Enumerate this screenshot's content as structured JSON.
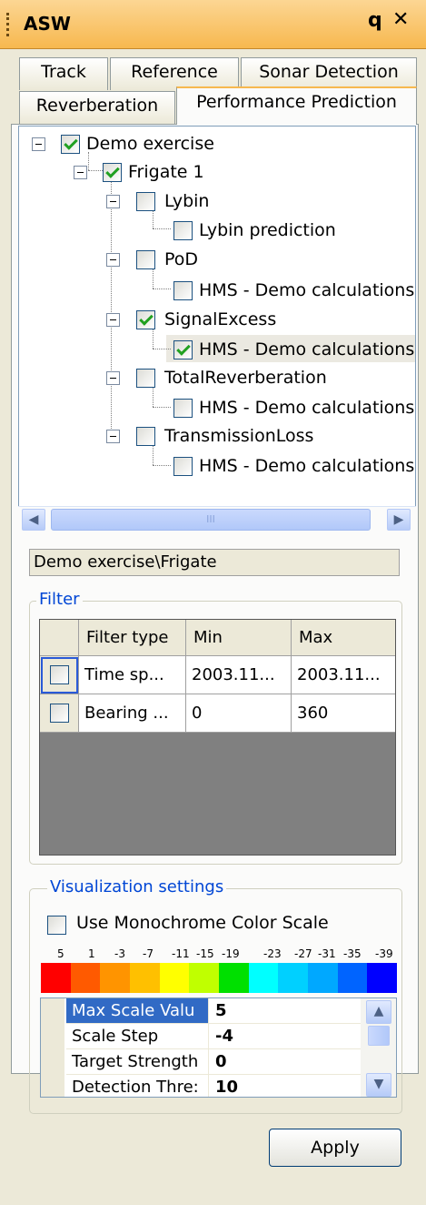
{
  "window": {
    "title": "ASW"
  },
  "tabs": {
    "row1": [
      "Track",
      "Reference",
      "Sonar Detection"
    ],
    "row2": [
      "Reverberation",
      "Performance Prediction"
    ]
  },
  "tree": {
    "nodes": [
      {
        "label": "Demo exercise",
        "checked": true
      },
      {
        "label": "Frigate 1",
        "checked": true
      },
      {
        "label": "Lybin",
        "checked": false
      },
      {
        "label": "Lybin prediction",
        "checked": false
      },
      {
        "label": "PoD",
        "checked": false
      },
      {
        "label": "HMS - Demo calculations",
        "checked": false
      },
      {
        "label": "SignalExcess",
        "checked": true
      },
      {
        "label": "HMS - Demo calculations",
        "checked": true
      },
      {
        "label": "TotalReverberation",
        "checked": false
      },
      {
        "label": "HMS - Demo calculations",
        "checked": false
      },
      {
        "label": "TransmissionLoss",
        "checked": false
      },
      {
        "label": "HMS - Demo calculations",
        "checked": false
      }
    ],
    "scroll_thumb_glyph": "III"
  },
  "path": "Demo exercise\\Frigate",
  "filter": {
    "legend": "Filter",
    "headers": [
      "Filter type",
      "Min",
      "Max"
    ],
    "rows": [
      [
        "Time sp...",
        "2003.11...",
        "2003.11..."
      ],
      [
        "Bearing ...",
        "0",
        "360"
      ]
    ]
  },
  "visualization": {
    "legend": "Visualization settings",
    "monochrome_label": "Use Monochrome Color Scale",
    "scale_labels": [
      "5",
      "1",
      "-3",
      "-7",
      "-11",
      "-15",
      "-19",
      "-23",
      "-27",
      "-31",
      "-35",
      "-39"
    ],
    "scale_colors": [
      "#ff0000",
      "#ff5a00",
      "#ff9400",
      "#ffc000",
      "#ffff00",
      "#c0ff00",
      "#00e000",
      "#00ffff",
      "#00d0ff",
      "#00a8ff",
      "#0064ff",
      "#0000ff"
    ],
    "properties": [
      {
        "name": "Max Scale Valu",
        "value": "5"
      },
      {
        "name": "Scale Step",
        "value": "-4"
      },
      {
        "name": "Target Strength",
        "value": "0"
      },
      {
        "name": "Detection Thre:",
        "value": "10"
      }
    ]
  },
  "apply_label": "Apply"
}
